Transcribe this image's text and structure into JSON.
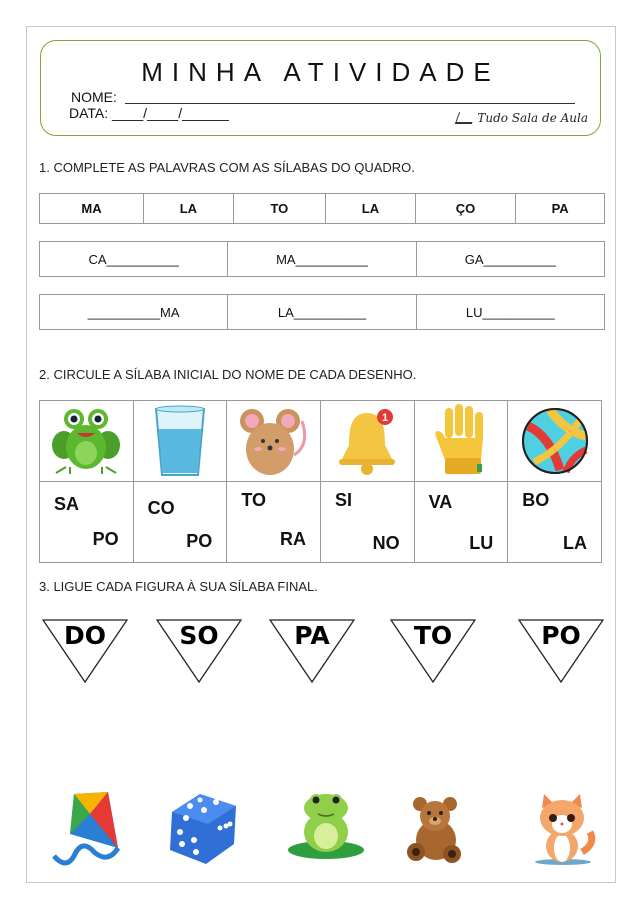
{
  "header": {
    "title": "MINHA ATIVIDADE",
    "nome_label": "NOME:",
    "data_label": "DATA: ____/____/______",
    "logo_text": "Tudo Sala de Aula",
    "border_color": "#7aa83a"
  },
  "q1": {
    "instruction": "1. COMPLETE AS PALAVRAS COM AS SÍLABAS DO QUADRO.",
    "syllables": [
      "MA",
      "LA",
      "TO",
      "LA",
      "ÇO",
      "PA"
    ],
    "row1": [
      "CA__________",
      "MA__________",
      "GA__________"
    ],
    "row2": [
      "__________MA",
      "LA__________",
      "LU__________"
    ]
  },
  "q2": {
    "instruction": "2. CIRCULE A SÍLABA INICIAL DO NOME DE CADA DESENHO.",
    "items": [
      {
        "picture": "frog-icon",
        "top": "SA",
        "bottom": "PO"
      },
      {
        "picture": "glass-of-water-icon",
        "top": "CO",
        "bottom": "PO"
      },
      {
        "picture": "mouse-icon",
        "top": "TO",
        "bottom": "RA"
      },
      {
        "picture": "bell-icon",
        "top": "SI",
        "bottom": "NO"
      },
      {
        "picture": "glove-icon",
        "top": "VA",
        "bottom": "LU"
      },
      {
        "picture": "ball-icon",
        "top": "BO",
        "bottom": "LA"
      }
    ],
    "bell_badge": "1"
  },
  "q3": {
    "instruction": "3. LIGUE CADA FIGURA À SUA SÍLABA FINAL.",
    "triangles": [
      "DO",
      "SO",
      "PA",
      "TO",
      "PO"
    ],
    "figures": [
      "kite-icon",
      "dice-icon",
      "frog-icon",
      "teddy-bear-icon",
      "cat-icon"
    ]
  }
}
